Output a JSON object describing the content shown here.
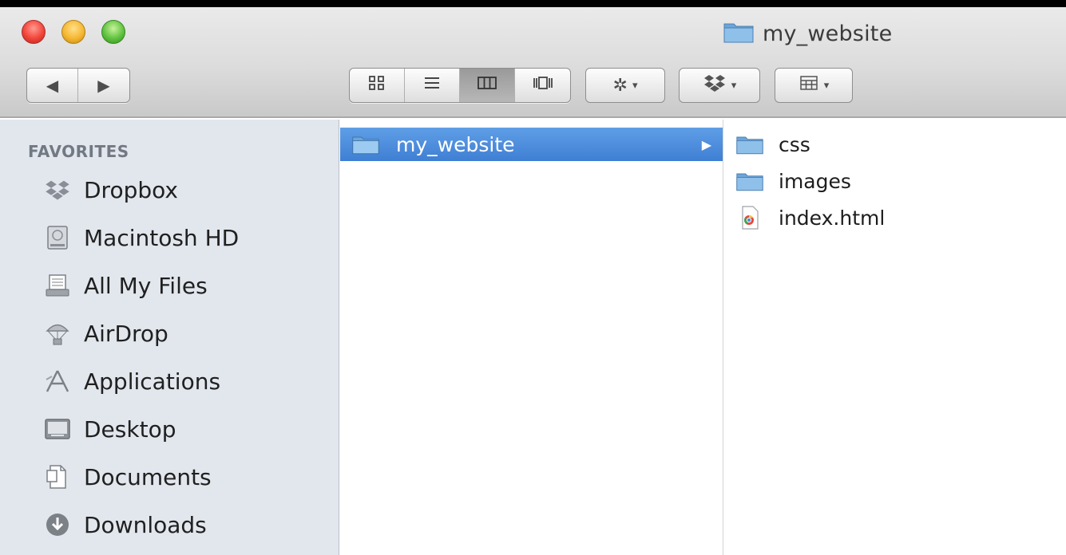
{
  "window": {
    "title": "my_website"
  },
  "toolbar": {
    "back_glyph": "◀",
    "forward_glyph": "▶",
    "view_icons": [
      "view-icons-icon",
      "view-list-icon",
      "view-columns-icon",
      "view-coverflow-icon"
    ],
    "action_glyph": "✲",
    "dropdown_glyph": "▾"
  },
  "sidebar": {
    "heading": "FAVORITES",
    "items": [
      {
        "label": "Dropbox",
        "icon": "dropbox-icon"
      },
      {
        "label": "Macintosh HD",
        "icon": "hard-drive-icon"
      },
      {
        "label": "All My Files",
        "icon": "all-files-icon"
      },
      {
        "label": "AirDrop",
        "icon": "airdrop-icon"
      },
      {
        "label": "Applications",
        "icon": "applications-icon"
      },
      {
        "label": "Desktop",
        "icon": "desktop-icon"
      },
      {
        "label": "Documents",
        "icon": "documents-icon"
      },
      {
        "label": "Downloads",
        "icon": "downloads-icon"
      }
    ]
  },
  "columns": {
    "first": [
      {
        "name": "my_website",
        "selected": true,
        "disclosure": "▶"
      }
    ],
    "second": [
      {
        "name": "css",
        "kind": "folder"
      },
      {
        "name": "images",
        "kind": "folder"
      },
      {
        "name": "index.html",
        "kind": "html-file"
      }
    ]
  },
  "colors": {
    "selection": "#4a8ddc",
    "sidebar_bg": "#e2e7ee",
    "folder": "#7fb2e0"
  }
}
